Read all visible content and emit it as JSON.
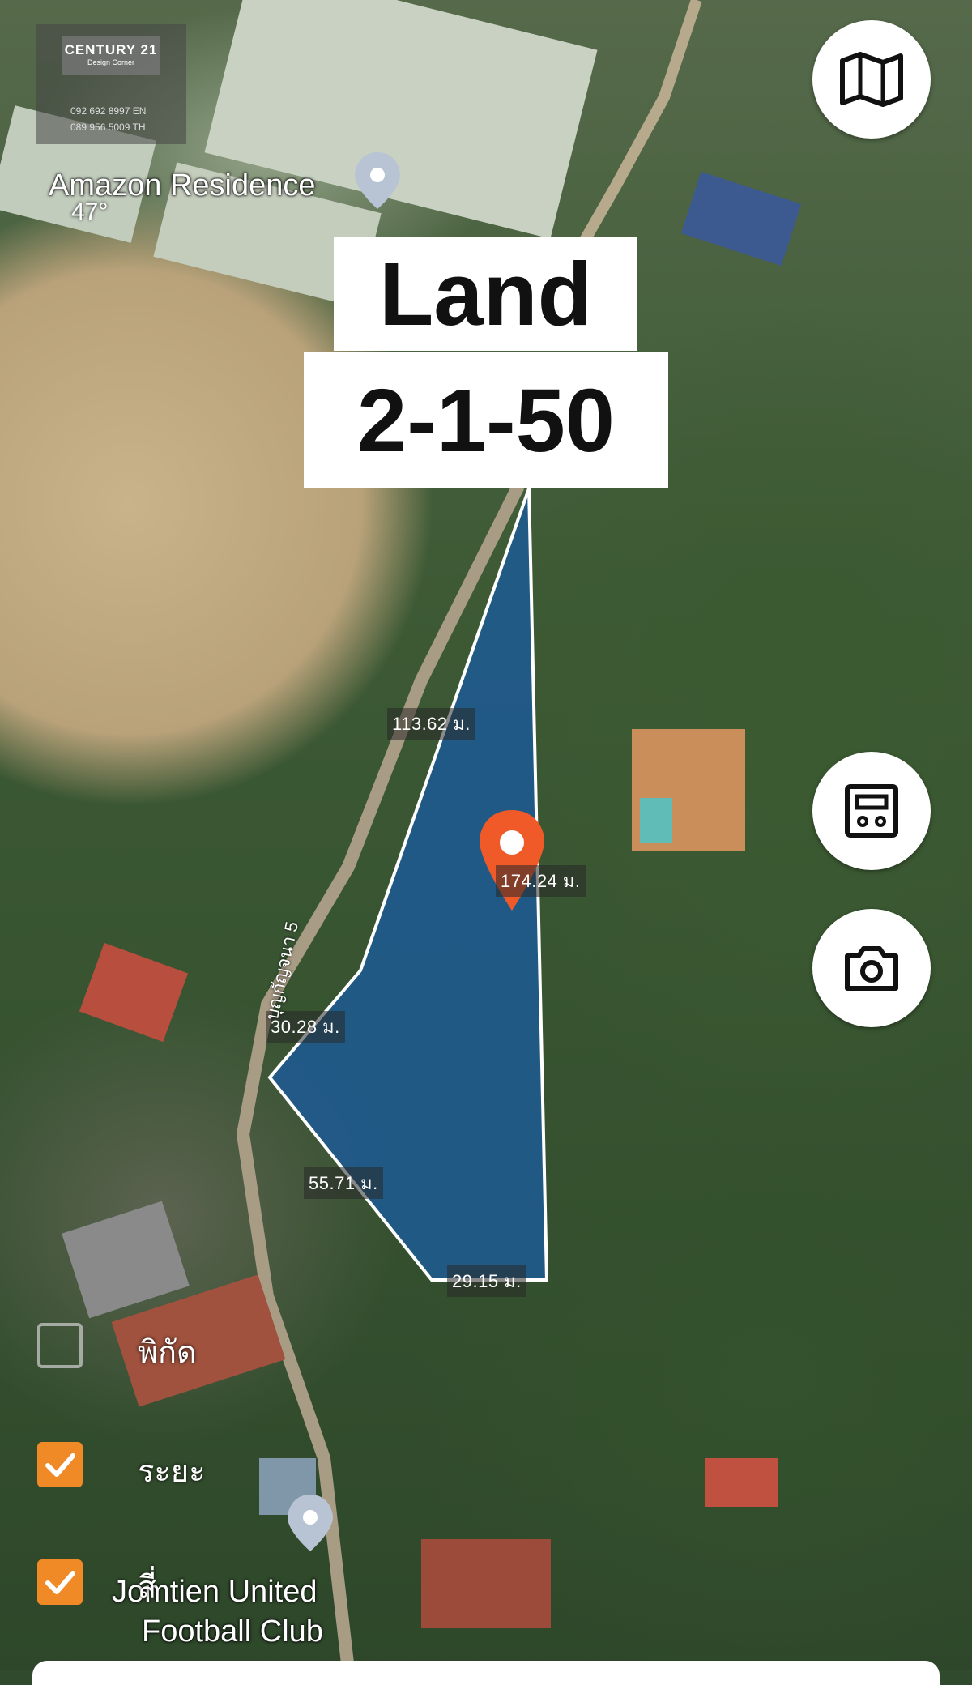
{
  "map": {
    "places": {
      "amazon_residence": "Amazon Residence",
      "jomtien_line1": "Jomtien United",
      "jomtien_line2": "Football Club"
    },
    "temperature": "47°",
    "road_name": "บุญกัญจนา 5"
  },
  "plot": {
    "title_line1": "Land",
    "title_line2": "2-1-50",
    "measurements": {
      "west_upper": "113.62 ม.",
      "east": "174.24 ม.",
      "west_mid": "30.28 ม.",
      "southwest": "55.71 ม.",
      "south": "29.15 ม."
    },
    "fill_color": "#1f5a8f",
    "marker_color": "#f05a28"
  },
  "logo": {
    "brand": "CENTURY 21",
    "sub": "Design Corner",
    "phone_en": "092 692 8997 EN",
    "phone_th": "089 956 5009 TH"
  },
  "controls": {
    "map_type_icon": "map-icon",
    "measure_icon": "ruler-tool-icon",
    "camera_icon": "camera-icon"
  },
  "layers": [
    {
      "label": "พิกัด",
      "checked": false
    },
    {
      "label": "ระยะ",
      "checked": true
    },
    {
      "label": "สี่",
      "checked": true
    }
  ],
  "colors": {
    "accent": "#f08a27",
    "label_bg": "#3a3a3a",
    "outline": "#ffffff"
  }
}
